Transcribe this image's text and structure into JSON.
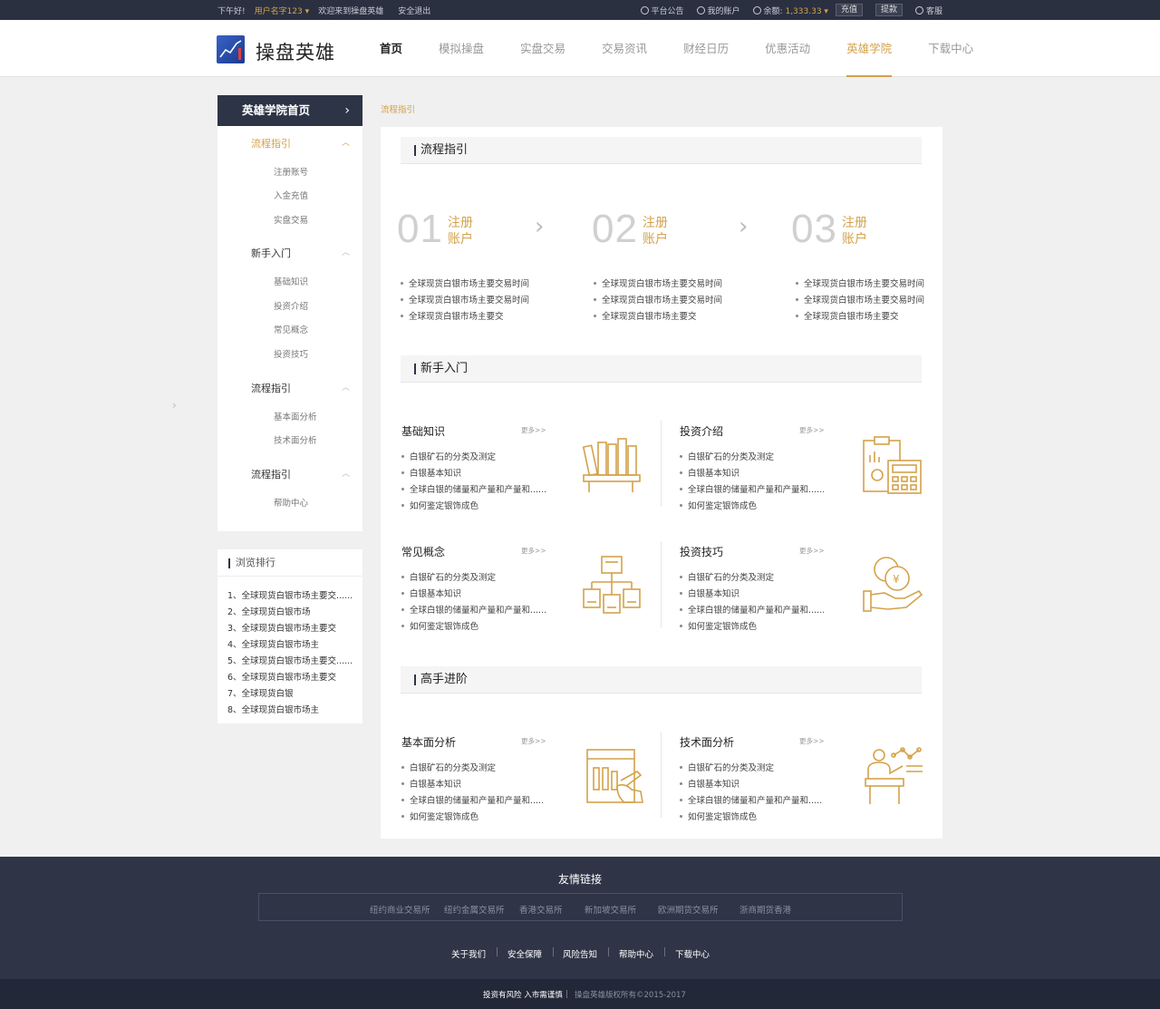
{
  "topbar": {
    "greeting": "下午好!",
    "username": "用户名字123",
    "welcome": "欢迎来到操盘英雄",
    "logout": "安全退出",
    "announce": "平台公告",
    "account": "我的账户",
    "balance_label": "余额:",
    "balance_value": "1,333.33",
    "recharge": "充值",
    "withdraw": "提款",
    "service": "客服"
  },
  "header": {
    "logo_text": "操盘英雄",
    "nav": [
      {
        "label": "首页"
      },
      {
        "label": "模拟操盘"
      },
      {
        "label": "实盘交易"
      },
      {
        "label": "交易资讯"
      },
      {
        "label": "财经日历"
      },
      {
        "label": "优惠活动"
      },
      {
        "label": "英雄学院"
      },
      {
        "label": "下载中心"
      }
    ]
  },
  "sidebar": {
    "head": "英雄学院首页",
    "groups": [
      {
        "label": "流程指引",
        "items": [
          "注册账号",
          "入金充值",
          "实盘交易"
        ]
      },
      {
        "label": "新手入门",
        "items": [
          "基础知识",
          "投资介绍",
          "常见概念",
          "投资技巧"
        ]
      },
      {
        "label": "流程指引",
        "items": [
          "基本面分析",
          "技术面分析"
        ]
      },
      {
        "label": "流程指引",
        "items": [
          "帮助中心"
        ]
      }
    ]
  },
  "ranking": {
    "title": "浏览排行",
    "items": [
      "1、全球现货白银市场主要交......",
      "2、全球现货白银市场",
      "3、全球现货白银市场主要交",
      "4、全球现货白银市场主",
      "5、全球现货白银市场主要交......",
      "6、全球现货白银市场主要交",
      "7、全球现货白银",
      "8、全球现货白银市场主"
    ]
  },
  "breadcrumb": "流程指引",
  "main": {
    "sec1_title": "流程指引",
    "steps": [
      {
        "num": "01",
        "l1": "注册",
        "l2": "账户"
      },
      {
        "num": "02",
        "l1": "注册",
        "l2": "账户"
      },
      {
        "num": "03",
        "l1": "注册",
        "l2": "账户"
      }
    ],
    "step_bullets": [
      "全球现货白银市场主要交易时间",
      "全球现货白银市场主要交易时间",
      "全球现货白银市场主要交"
    ],
    "sec2_title": "新手入门",
    "sec3_title": "高手进阶",
    "more": "更多>>",
    "cards": [
      {
        "title": "基础知识"
      },
      {
        "title": "投资介绍"
      },
      {
        "title": "常见概念"
      },
      {
        "title": "投资技巧"
      },
      {
        "title": "基本面分析"
      },
      {
        "title": "技术面分析"
      }
    ],
    "card_bullets": [
      "白银矿石的分类及测定",
      "白银基本知识",
      "全球白银的储量和产量和产量和......",
      "如何鉴定银饰成色"
    ],
    "card_bullets_short": [
      "白银矿石的分类及测定",
      "白银基本知识",
      "全球白银的储量和产量和产量和.....",
      "如何鉴定银饰成色"
    ]
  },
  "footer": {
    "title": "友情链接",
    "links": [
      "纽约商业交易所",
      "纽约金属交易所",
      "香港交易所",
      "新加坡交易所",
      "欧洲期货交易所",
      "浙商期货香港"
    ],
    "nav": [
      "关于我们",
      "安全保障",
      "风险告知",
      "帮助中心",
      "下载中心"
    ],
    "risk": "投资有风险 入市需谨慎",
    "copyright": "操盘英雄版权所有©2015-2017"
  },
  "colors": {
    "accent": "#d4a24a",
    "dark": "#2d3446"
  }
}
